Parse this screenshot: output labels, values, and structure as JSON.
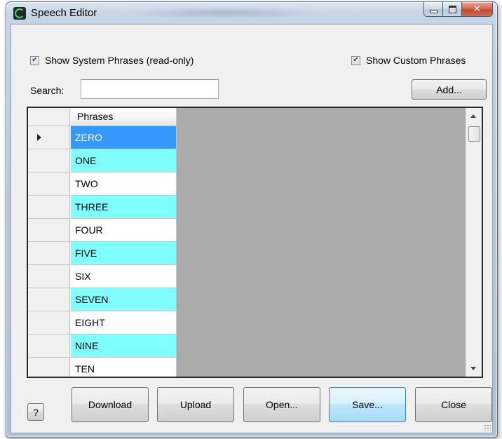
{
  "window": {
    "title": "Speech Editor"
  },
  "options": {
    "show_system": {
      "label": "Show System Phrases (read-only)",
      "checked": true
    },
    "show_custom": {
      "label": "Show Custom Phrases",
      "checked": true
    }
  },
  "search": {
    "label": "Search:",
    "value": ""
  },
  "add_label": "Add...",
  "grid": {
    "column_header": "Phrases",
    "selected_index": 0,
    "rows": [
      "ZERO",
      "ONE",
      "TWO",
      "THREE",
      "FOUR",
      "FIVE",
      "SIX",
      "SEVEN",
      "EIGHT",
      "NINE",
      "TEN"
    ],
    "highlight_color": "#80ffff",
    "selection_color": "#3399ff"
  },
  "buttons": {
    "help": "?",
    "download": "Download",
    "upload": "Upload",
    "open": "Open...",
    "save": "Save...",
    "close": "Close"
  }
}
